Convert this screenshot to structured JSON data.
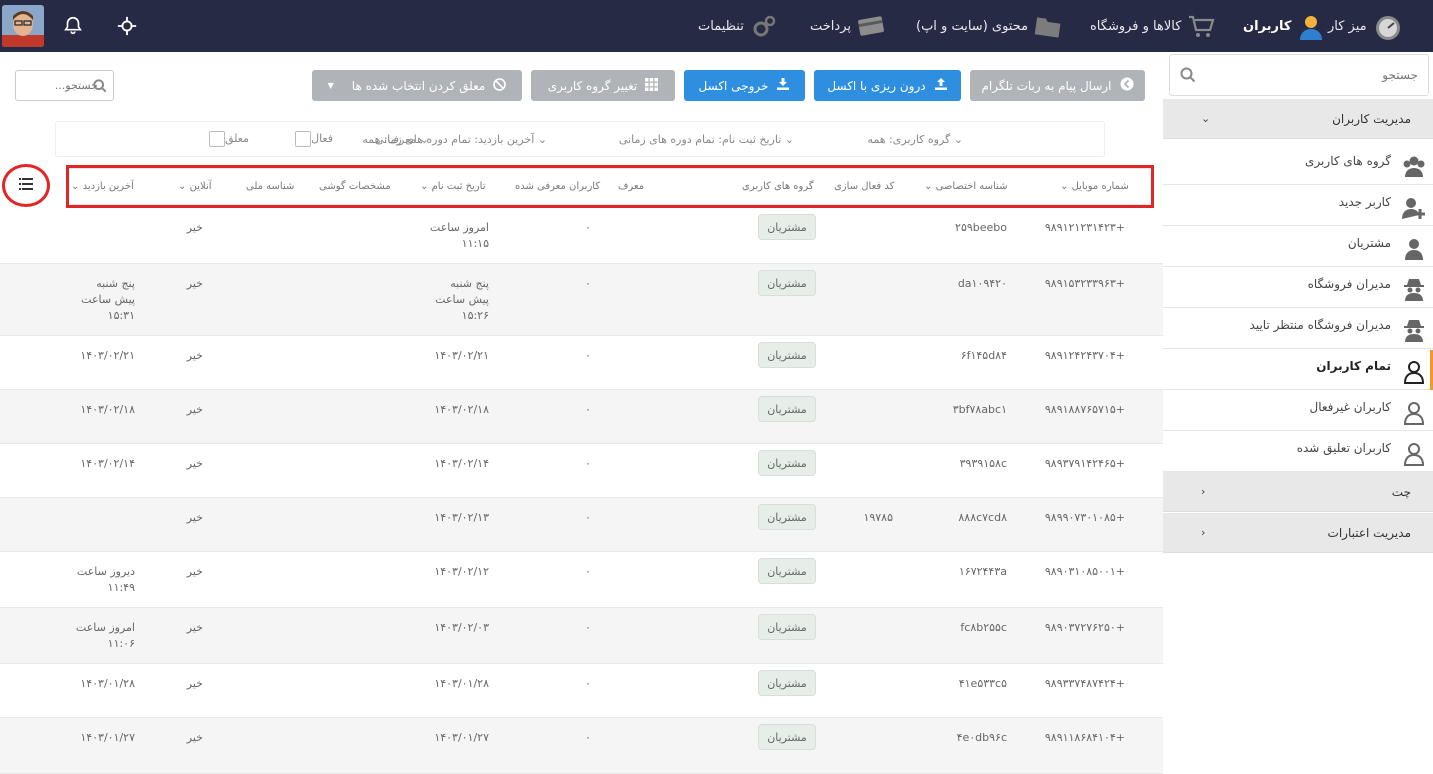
{
  "topbar": {
    "nav": [
      {
        "key": "dashboard",
        "label": "میز کار",
        "icon": "dashboard-gauge-icon"
      },
      {
        "key": "users",
        "label": "کاربران",
        "icon": "user-icon",
        "active": true
      },
      {
        "key": "products",
        "label": "کالاها و فروشگاه",
        "icon": "cart-icon"
      },
      {
        "key": "content",
        "label": "محتوی (سایت و اپ)",
        "icon": "folder-icon"
      },
      {
        "key": "payment",
        "label": "پرداخت",
        "icon": "credit-card-icon"
      },
      {
        "key": "settings",
        "label": "تنظیمات",
        "icon": "gears-icon"
      }
    ],
    "icons": [
      "avatar",
      "bell-icon",
      "crosshair-icon"
    ]
  },
  "sidebar": {
    "search_placeholder": "جستجو",
    "section_users": "مدیریت کاربران",
    "items": [
      {
        "label": "گروه های کاربری",
        "icon": "user-group-icon"
      },
      {
        "label": "کاربر جدید",
        "icon": "user-add-icon"
      },
      {
        "label": "مشتریان",
        "icon": "user-icon"
      },
      {
        "label": "مدیران فروشگاه",
        "icon": "spy-icon"
      },
      {
        "label": "مدیران فروشگاه منتظر تایید",
        "icon": "spy-icon"
      },
      {
        "label": "تمام کاربران",
        "icon": "user-outline-icon",
        "active": true
      },
      {
        "label": "کاربران غیرفعال",
        "icon": "user-outline-icon"
      },
      {
        "label": "کاربران تعلیق شده",
        "icon": "user-outline-icon"
      }
    ],
    "section_chat": "چت",
    "section_credit": "مدیریت اعتبارات"
  },
  "toolbar": {
    "telegram": "ارسال پیام به ربات تلگرام",
    "import_excel": "درون ریزی با اکسل",
    "export_excel": "خروجی اکسل",
    "change_group": "تغییر گروه کاربری",
    "suspend": "معلق کردن انتخاب شده ها",
    "search_placeholder": "جستجو..."
  },
  "filters": {
    "group": "گروه کاربری:  همه",
    "signup": "تاریخ ثبت نام: تمام دوره های زمانی",
    "last_visit": "آخرین بازدید: تمام دوره های زمانی",
    "referrer": "معرف:  همه",
    "active": "فعال",
    "suspended": "معلق"
  },
  "table": {
    "headers": {
      "mobile": "شماره موبایل",
      "code": "شناسه اختصاصی",
      "activation": "کد فعال سازی",
      "groups": "گروه های کاربری",
      "referrer": "معرف",
      "referred": "کاربران معرفی شده",
      "signup": "تاریخ ثبت نام",
      "phone": "مشخصات گوشی",
      "national": "شناسه ملی",
      "online": "آنلاین",
      "last_visit": "آخرین بازدید"
    },
    "rows": [
      {
        "mobile": "۹۸۹۱۲۱۲۳۱۴۲۳+",
        "code": "۲۵۹beebo",
        "activation": "",
        "group": "مشتریان",
        "referred": "۰",
        "signup": [
          "امروز ساعت",
          "۱۱:۱۵"
        ],
        "online": "خیر",
        "last": []
      },
      {
        "mobile": "۹۸۹۱۵۳۲۳۳۹۶۳+",
        "code": "da۱۰۹۴۲۰",
        "activation": "",
        "group": "مشتریان",
        "referred": "۰",
        "signup": [
          "پنج شنبه",
          "پیش ساعت",
          "۱۵:۲۶"
        ],
        "online": "خیر",
        "last": [
          "پنج شنبه",
          "پیش ساعت",
          "۱۵:۳۱"
        ]
      },
      {
        "mobile": "۹۸۹۱۲۴۲۴۳۷۰۴+",
        "code": "۶f۱۴۵d۸۴",
        "activation": "",
        "group": "مشتریان",
        "referred": "۰",
        "signup": [
          "۱۴۰۳/۰۲/۲۱"
        ],
        "online": "خیر",
        "last": [
          "۱۴۰۳/۰۲/۲۱"
        ]
      },
      {
        "mobile": "۹۸۹۱۸۸۷۶۵۷۱۵+",
        "code": "۳bf۷۸abc۱",
        "activation": "",
        "group": "مشتریان",
        "referred": "۰",
        "signup": [
          "۱۴۰۳/۰۲/۱۸"
        ],
        "online": "خیر",
        "last": [
          "۱۴۰۳/۰۲/۱۸"
        ]
      },
      {
        "mobile": "۹۸۹۳۷۹۱۴۲۴۶۵+",
        "code": "۳۹۳۹۱۵۸c",
        "activation": "",
        "group": "مشتریان",
        "referred": "۰",
        "signup": [
          "۱۴۰۳/۰۲/۱۴"
        ],
        "online": "خیر",
        "last": [
          "۱۴۰۳/۰۲/۱۴"
        ]
      },
      {
        "mobile": "۹۸۹۹۰۷۳۰۱۰۸۵+",
        "code": "۸۸۸c۷cd۸",
        "activation": "۱۹۷۸۵",
        "group": "مشتریان",
        "referred": "۰",
        "signup": [
          "۱۴۰۳/۰۲/۱۳"
        ],
        "online": "خیر",
        "last": []
      },
      {
        "mobile": "۹۸۹۰۳۱۰۸۵۰۰۱+",
        "code": "۱۶۷۲۴۴۳a",
        "activation": "",
        "group": "مشتریان",
        "referred": "۰",
        "signup": [
          "۱۴۰۳/۰۲/۱۲"
        ],
        "online": "خیر",
        "last": [
          "دیروز ساعت",
          "۱۱:۴۹"
        ]
      },
      {
        "mobile": "۹۸۹۰۳۷۲۷۶۲۵۰+",
        "code": "fc۸b۲۵۵c",
        "activation": "",
        "group": "مشتریان",
        "referred": "۰",
        "signup": [
          "۱۴۰۳/۰۲/۰۳"
        ],
        "online": "خیر",
        "last": [
          "امروز ساعت",
          "۱۱:۰۶"
        ]
      },
      {
        "mobile": "۹۸۹۳۳۷۴۸۷۴۲۴+",
        "code": "۴۱e۵۳۳c۵",
        "activation": "",
        "group": "مشتریان",
        "referred": "۰",
        "signup": [
          "۱۴۰۳/۰۱/۲۸"
        ],
        "online": "خیر",
        "last": [
          "۱۴۰۳/۰۱/۲۸"
        ]
      },
      {
        "mobile": "۹۸۹۱۱۸۶۸۴۱۰۴+",
        "code": "۴e۰db۹۶c",
        "activation": "",
        "group": "مشتریان",
        "referred": "۰",
        "signup": [
          "۱۴۰۳/۰۱/۲۷"
        ],
        "online": "خیر",
        "last": [
          "۱۴۰۳/۰۱/۲۷"
        ]
      }
    ]
  },
  "colors": {
    "topbar": "#262a44",
    "primary_button": "#2e8fe0",
    "disabled_button": "#b0b3b7",
    "highlight": "#e02626",
    "active_indicator": "#f09a2e"
  }
}
